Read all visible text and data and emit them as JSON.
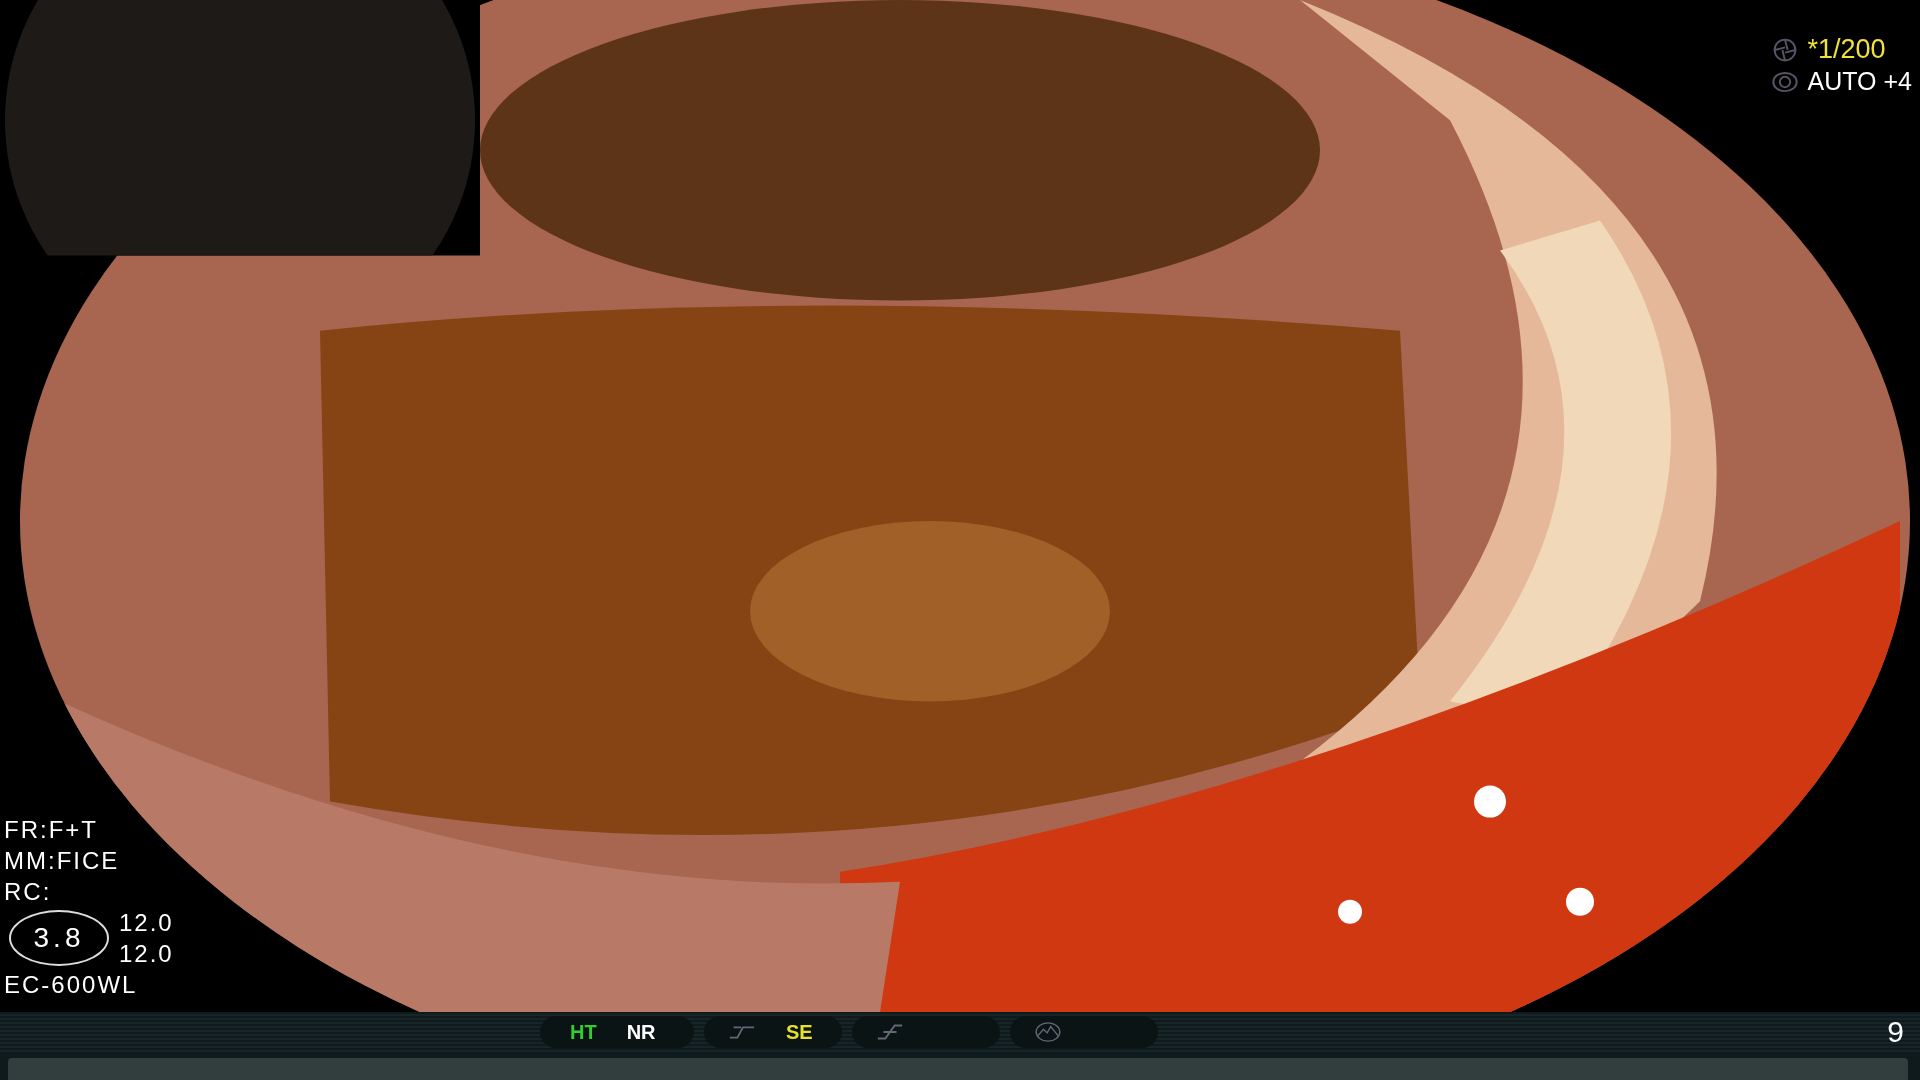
{
  "exposure": {
    "shutter": "*1/200",
    "iris": "AUTO +4"
  },
  "info": {
    "lines": [
      "FR:F+T",
      "MM:FICE",
      "RC:"
    ],
    "zoom": "3.8",
    "values": [
      "12.0",
      "12.0"
    ],
    "scope": "EC-600WL"
  },
  "status_bar": {
    "groups": [
      {
        "items": [
          {
            "label": "HT",
            "color": "#33cc33"
          },
          {
            "label": "NR",
            "color": "#ffffff"
          }
        ]
      },
      {
        "items": [
          {
            "label": "SE",
            "color": "#e8e030"
          }
        ]
      }
    ],
    "page": "9"
  }
}
